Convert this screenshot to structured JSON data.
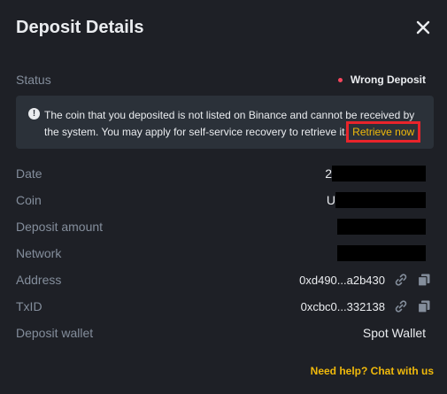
{
  "dialog": {
    "title": "Deposit Details",
    "close_icon": "close-icon"
  },
  "status": {
    "label": "Status",
    "value": "Wrong Deposit",
    "dot_color": "#f6465d"
  },
  "notice": {
    "icon": "exclamation-circle-icon",
    "text": "The coin that you deposited is not listed on Binance and cannot be received by the system. You may apply for self-service recovery to retrieve it.",
    "link_label": "Retrieve now"
  },
  "details": {
    "date": {
      "label": "Date",
      "visible_prefix": "2"
    },
    "coin": {
      "label": "Coin",
      "visible_prefix": "U"
    },
    "amount": {
      "label": "Deposit amount"
    },
    "network": {
      "label": "Network"
    },
    "address": {
      "label": "Address",
      "value": "0xd490...a2b430"
    },
    "txid": {
      "label": "TxID",
      "value": "0xcbc0...332138"
    },
    "wallet": {
      "label": "Deposit wallet",
      "value": "Spot Wallet"
    }
  },
  "footer": {
    "help_label": "Need help? Chat with us"
  },
  "colors": {
    "background": "#1e2026",
    "panel": "#2b3139",
    "accent": "#f0b90b",
    "muted_text": "#848e9c",
    "highlight_box": "#e8242b"
  }
}
